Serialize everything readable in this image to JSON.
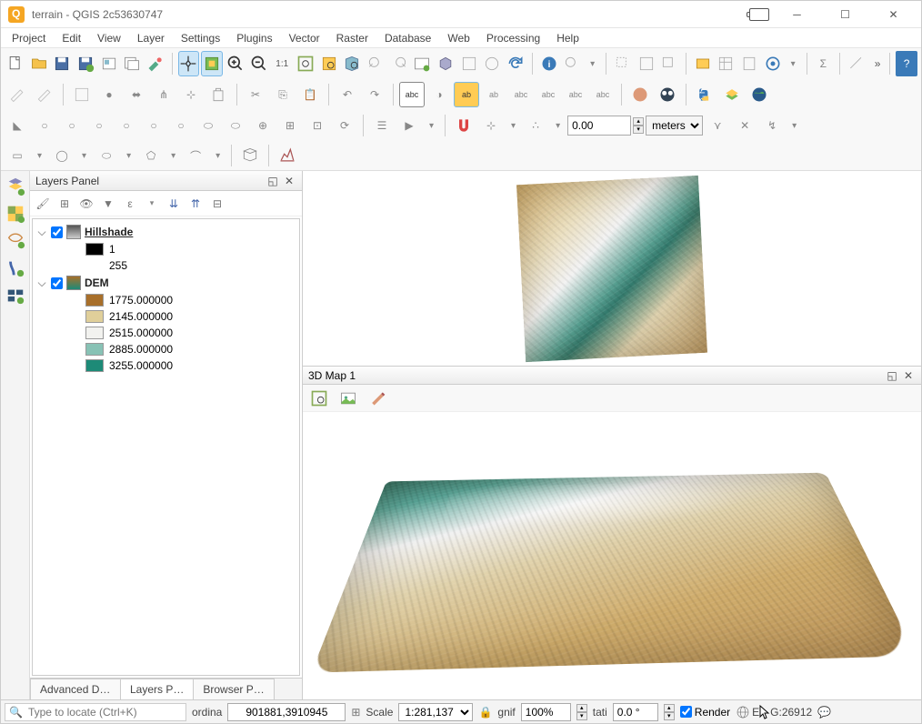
{
  "window": {
    "title": "terrain - QGIS 2c53630747"
  },
  "menu": [
    "Project",
    "Edit",
    "View",
    "Layer",
    "Settings",
    "Plugins",
    "Vector",
    "Raster",
    "Database",
    "Web",
    "Processing",
    "Help"
  ],
  "snapping": {
    "distance": "0.00",
    "units": "meters"
  },
  "layers_panel": {
    "title": "Layers Panel",
    "layers": [
      {
        "name": "Hillshade",
        "checked": true,
        "expanded": true,
        "legend": [
          {
            "color": "#000000",
            "label": "1"
          },
          {
            "color": null,
            "label": "255"
          }
        ]
      },
      {
        "name": "DEM",
        "checked": true,
        "expanded": true,
        "legend": [
          {
            "color": "#a86f2a",
            "label": "1775.000000"
          },
          {
            "color": "#e0cf9a",
            "label": "2145.000000"
          },
          {
            "color": "#f2f2ef",
            "label": "2515.000000"
          },
          {
            "color": "#88c2b5",
            "label": "2885.000000"
          },
          {
            "color": "#1d8a77",
            "label": "3255.000000"
          }
        ]
      }
    ]
  },
  "bottom_tabs": [
    "Advanced Digitizing P…",
    "Layers P…",
    "Browser P…"
  ],
  "map3d": {
    "title": "3D Map 1"
  },
  "status": {
    "locate_placeholder": "Type to locate (Ctrl+K)",
    "coord_label": "ordina",
    "coord_value": "901881,3910945",
    "scale_label": "Scale",
    "scale_value": "1:281,137",
    "magnifier_label": "gnif",
    "magnifier_value": "100%",
    "rotation_label": "tati",
    "rotation_value": "0.0 °",
    "render_label": "Render",
    "epsg": "G:26912",
    "epsg_prefix": "E"
  }
}
